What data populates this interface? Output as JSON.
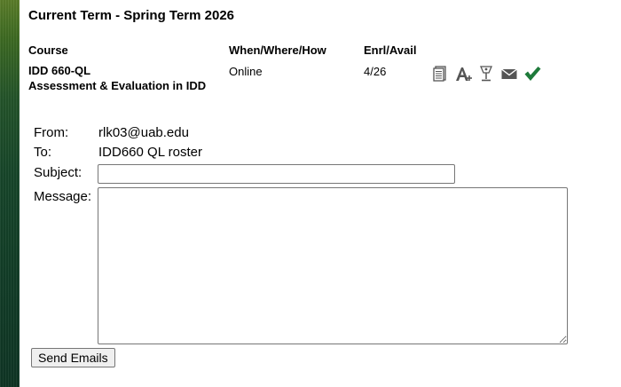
{
  "term": {
    "title": "Current Term - Spring Term 2026"
  },
  "table": {
    "headers": {
      "course": "Course",
      "when": "When/Where/How",
      "enrl": "Enrl/Avail"
    },
    "row": {
      "code": "IDD 660-QL",
      "name": "Assessment & Evaluation in IDD",
      "when": "Online",
      "enrl": "4/26",
      "icons": [
        "roster-icon",
        "grades-icon",
        "tools-icon",
        "email-icon",
        "checkmark-icon"
      ]
    }
  },
  "form": {
    "from_label": "From:",
    "from_value": "rlk03@uab.edu",
    "to_label": "To:",
    "to_value": "IDD660 QL roster",
    "subject_label": "Subject:",
    "subject_value": "",
    "message_label": "Message:",
    "message_value": "",
    "send_label": "Send Emails"
  },
  "colors": {
    "sidebar": "#1a4a2c",
    "check": "#1e7a3a",
    "icon_gray": "#555555"
  }
}
